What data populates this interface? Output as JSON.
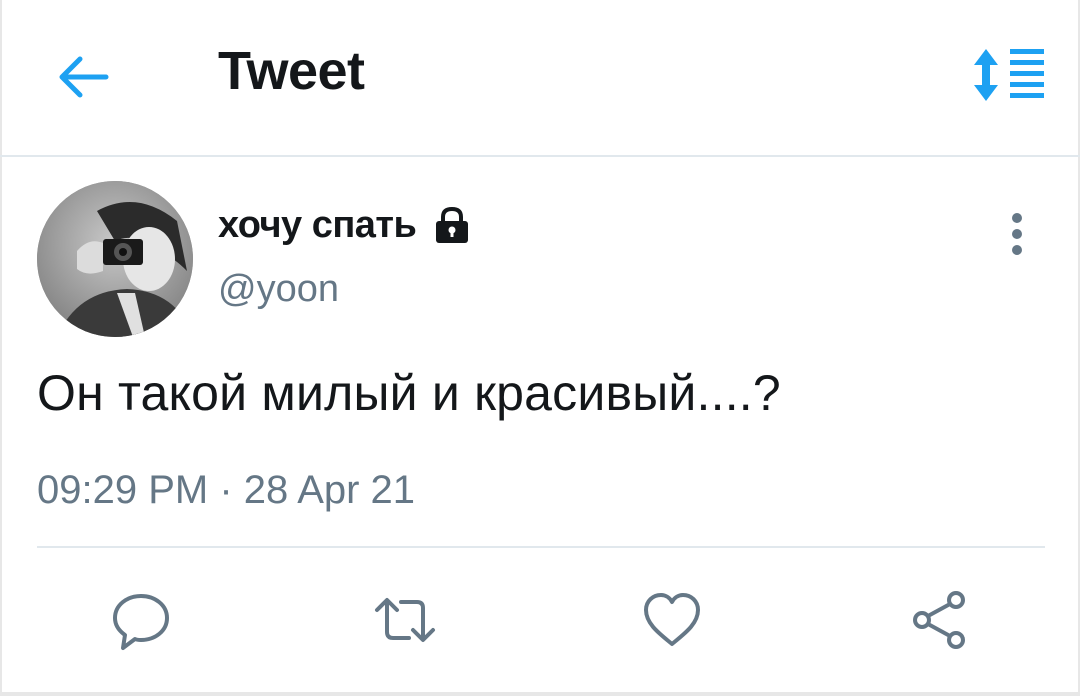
{
  "header": {
    "back_icon": "arrow-left-icon",
    "title": "Tweet",
    "sort_icon": "sort-list-icon",
    "accent_color": "#1da1f2"
  },
  "tweet": {
    "avatar_icon": "user-avatar-photo",
    "display_name": "хочу спать",
    "protected_icon": "lock-icon",
    "handle": "@yoon",
    "more_icon": "more-vertical-icon",
    "text": "Он такой милый и красивый....?",
    "time": "09:29 PM",
    "separator": "·",
    "date": "28 Apr 21"
  },
  "actions": [
    {
      "icon": "reply-icon"
    },
    {
      "icon": "retweet-icon"
    },
    {
      "icon": "like-icon"
    },
    {
      "icon": "share-icon"
    }
  ],
  "colors": {
    "text_primary": "#14171a",
    "text_secondary": "#657786",
    "divider": "#e1e8ed",
    "accent": "#1da1f2"
  }
}
